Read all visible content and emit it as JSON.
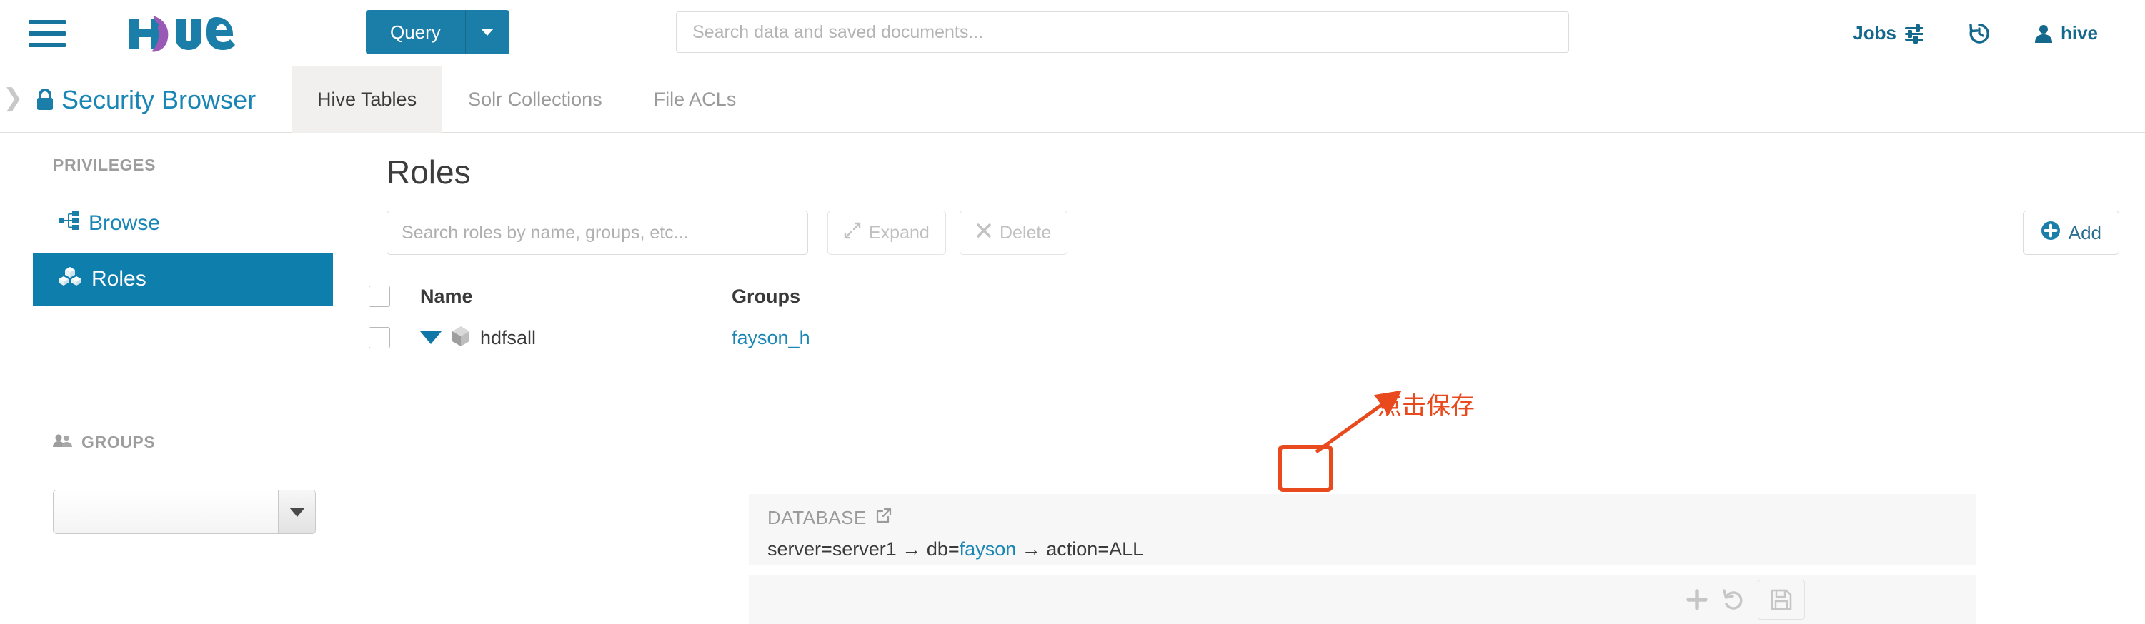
{
  "navbar": {
    "hamburger_icon": "hamburger-menu-icon",
    "logo_text": "hue",
    "query_label": "Query",
    "query_caret_icon": "chevron-down-icon",
    "search_placeholder": "Search data and saved documents...",
    "search_value": "",
    "right_items": [
      {
        "label": "Jobs",
        "icon": "sliders-icon"
      },
      {
        "label": "",
        "icon": "history-icon"
      },
      {
        "label": "hive",
        "icon": "user-icon"
      }
    ]
  },
  "subheader": {
    "collapse_icon": "chevron-right-icon",
    "lock_icon": "lock-icon",
    "title": "Security Browser",
    "tabs": [
      {
        "label": "Hive Tables",
        "active": true
      },
      {
        "label": "Solr Collections",
        "active": false
      },
      {
        "label": "File ACLs",
        "active": false
      }
    ]
  },
  "sidebar": {
    "privileges_label": "PRIVILEGES",
    "items": [
      {
        "label": "Browse",
        "icon": "sitemap-icon",
        "active": false
      },
      {
        "label": "Roles",
        "icon": "cubes-icon",
        "active": true
      }
    ],
    "groups_label": "GROUPS",
    "groups_icon": "users-icon",
    "group_select_value": "",
    "group_select_arrow_icon": "caret-down-icon"
  },
  "main": {
    "page_title": "Roles",
    "search_placeholder": "Search roles by name, groups, etc...",
    "search_value": "",
    "expand_label": "Expand",
    "expand_icon": "expand-arrows-icon",
    "delete_label": "Delete",
    "delete_icon": "times-icon",
    "add_label": "Add",
    "add_icon": "plus-circle-icon",
    "table": {
      "columns": [
        "Name",
        "Groups"
      ],
      "rows": [
        {
          "name": "hdfsall",
          "groups": "fayson_h",
          "expanded": true,
          "role_icon": "cube-icon",
          "toggle_icon": "caret-down-icon",
          "checkbox_checked": false
        }
      ]
    },
    "privilege": {
      "kind": "DATABASE",
      "external_link_icon": "external-link-icon",
      "path_prefix": "server=server1",
      "arrow": "→",
      "path_db_label": "db=",
      "path_db_value": "fayson",
      "path_action": "action=ALL",
      "actions": [
        {
          "name": "add-privilege",
          "icon": "plus-icon"
        },
        {
          "name": "undo-privilege",
          "icon": "undo-icon"
        },
        {
          "name": "save-privilege",
          "icon": "floppy-save-icon"
        }
      ]
    }
  },
  "annotation": {
    "text": "点击保存",
    "color": "#e8491d"
  },
  "colors": {
    "brand_blue": "#1a7ea8",
    "active_item": "#0e7ead",
    "link": "#1a86b5",
    "annotation": "#e8491d"
  }
}
